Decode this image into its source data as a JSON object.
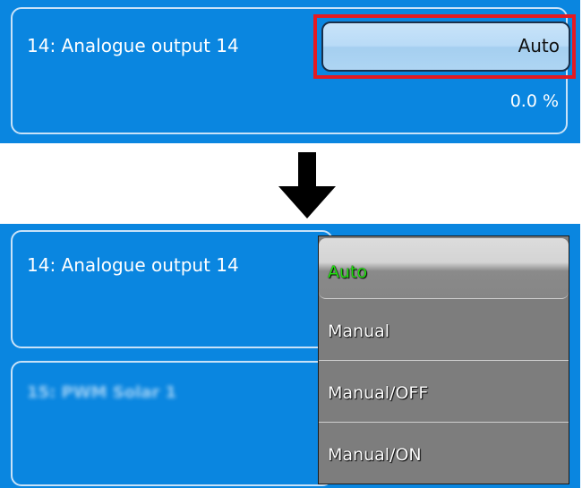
{
  "top_panel": {
    "output_title": "14: Analogue output 14",
    "mode_value": "Auto",
    "output_value": "0.0 %"
  },
  "bottom_panel": {
    "output_title": "14: Analogue output 14",
    "next_output_title_blurred": "15: PWM Solar 1",
    "dropdown": {
      "selected": "Auto",
      "options": [
        "Auto",
        "Manual",
        "Manual/OFF",
        "Manual/ON"
      ]
    }
  },
  "colors": {
    "panel_bg": "#0a86e0",
    "highlight_border": "#e41a22",
    "selected_option_text": "#22dd11",
    "dropdown_bg": "#7d7d7d"
  },
  "icons": {
    "arrow": "arrow-down-icon"
  }
}
